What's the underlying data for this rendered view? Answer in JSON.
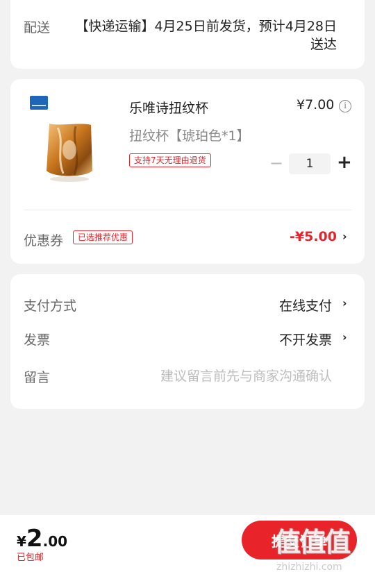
{
  "shipping": {
    "label": "配送",
    "text": "【快递运输】4月25日前发货，预计4月28日送达"
  },
  "product": {
    "title": "乐唯诗扭纹杯",
    "price": "¥7.00",
    "spec": "扭纹杯【琥珀色*1】",
    "return_tag": "支持7天无理由退货",
    "quantity": "1",
    "minus": "−",
    "plus": "+"
  },
  "coupon": {
    "label": "优惠券",
    "tag": "已选推荐优惠",
    "value": "-¥5.00"
  },
  "payment": {
    "method_label": "支付方式",
    "method_value": "在线支付",
    "invoice_label": "发票",
    "invoice_value": "不开发票",
    "message_label": "留言",
    "message_placeholder": "建议留言前先与商家沟通确认"
  },
  "footer": {
    "currency": "¥",
    "total_int": "2",
    "total_dec": ".00",
    "free_shipping": "已包邮",
    "submit": "提交订单"
  },
  "watermark": {
    "text": "值值值",
    "url": "zhizhizhi.com"
  },
  "colors": {
    "accent": "#e8232a",
    "background": "#f2f2f2"
  }
}
